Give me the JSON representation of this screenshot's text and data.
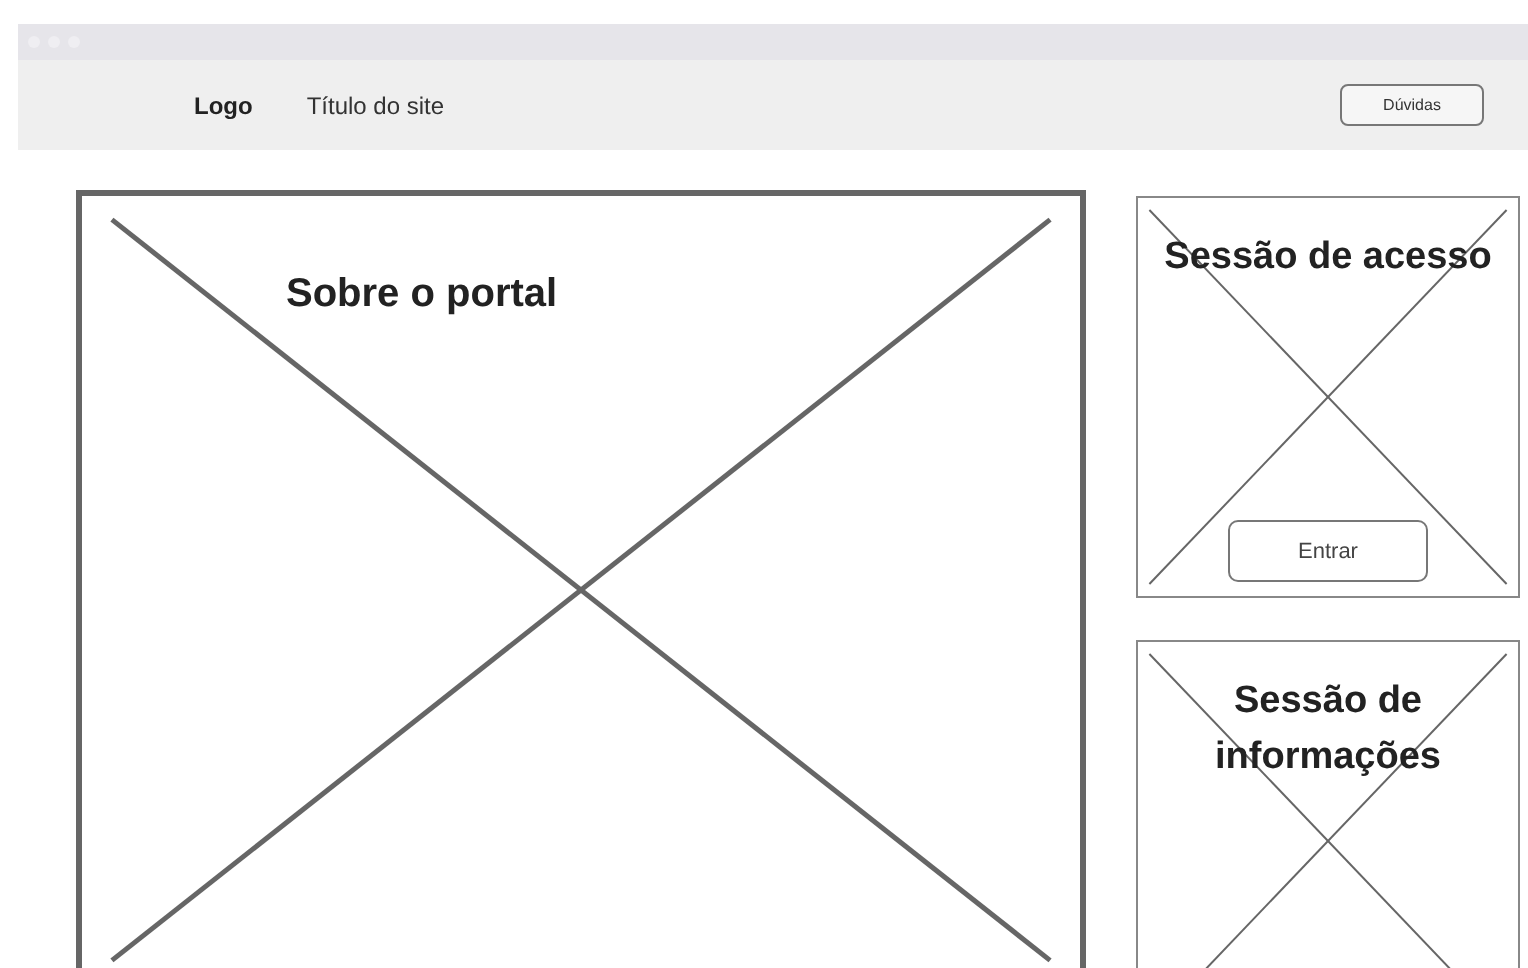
{
  "header": {
    "logo": "Logo",
    "title": "Título do site",
    "help_button": "Dúvidas"
  },
  "main_panel": {
    "title": "Sobre o portal"
  },
  "side_panels": [
    {
      "title": "Sessão de acesso",
      "button": "Entrar"
    },
    {
      "title": "Sessão de informações"
    }
  ]
}
